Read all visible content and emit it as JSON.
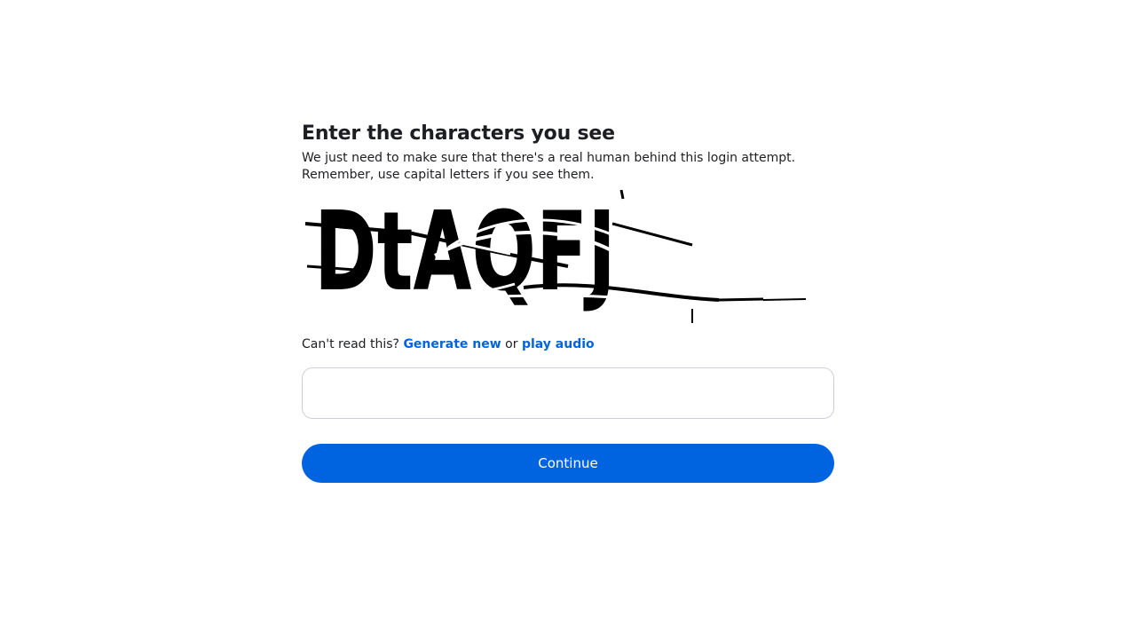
{
  "page": {
    "heading": "Enter the characters you see",
    "description_line1": "We just need to make sure that there's a real human behind this login attempt.",
    "description_line2": "Remember, use capital letters if you see them."
  },
  "captcha": {
    "text": "DtAQFJ"
  },
  "help": {
    "prefix": "Can't read this?",
    "generate_new_label": "Generate new",
    "or": "or",
    "play_audio_label": "play audio"
  },
  "input": {
    "value": "",
    "placeholder": ""
  },
  "actions": {
    "continue_label": "Continue"
  },
  "colors": {
    "accent": "#0064e0",
    "text": "#1c1e21",
    "border": "#ccd0d5"
  }
}
